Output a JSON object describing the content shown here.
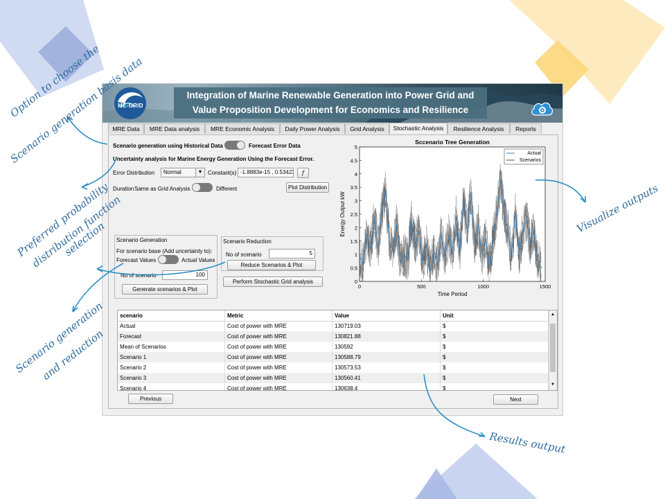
{
  "app": {
    "title_line1": "Integration of Marine Renewable Generation into Power Grid and",
    "title_line2": "Value Proposition Development for Economics and Resilience",
    "logo_text": "ME-GRID",
    "tabs": [
      "MRE Data",
      "MRE Data analysis",
      "MRE Economic Analysis",
      "Daily Power Analysis",
      "Grid Analysis",
      "Stochastic Analysis",
      "Resilience Analysis",
      "Reports"
    ],
    "active_tab": "Stochastic Analysis"
  },
  "controls": {
    "scen_gen_label": "Scenario generation using Historical Data",
    "forecast_error_label": "Forecast Error Data",
    "uncertainty_heading": "Uncertainty analysis for Marine Energy Generation Using the Forecast Error.",
    "error_dist_label": "Error Distribution",
    "error_dist_value": "Normal",
    "constants_label": "Constant(s)",
    "constants_value": "-1.8883e-15 , 0.53423",
    "fx_label": "f",
    "duration_label": "Duration",
    "same_as_grid_label": "Same as Grid Analysis",
    "different_label": "Different",
    "plot_dist_button": "Plot Distribution"
  },
  "scenario_generation": {
    "title": "Scenario Generation",
    "basis_label": "For scenario base (Add uncertainty to):",
    "forecast_values_label": "Forecast Values",
    "actual_values_label": "Actual Values",
    "no_scenario_label": "No of scenario",
    "no_scenario_value": "100",
    "generate_button": "Generate scenarios & Plot"
  },
  "scenario_reduction": {
    "title": "Scenario Reduction",
    "no_scenario_label": "No of scenario",
    "no_scenario_value": "5",
    "reduce_button": "Reduce Scenarios & Plot",
    "stochastic_button": "Perform Stochastic Grid analysis"
  },
  "chart_data": {
    "type": "line",
    "title": "Sccenario Tree Generation",
    "xlabel": "Time Period",
    "ylabel": "Energy Output kW",
    "xlim": [
      0,
      1500
    ],
    "ylim": [
      0,
      5
    ],
    "x_ticks": [
      "0",
      "500",
      "1000",
      "1500"
    ],
    "y_ticks": [
      "0",
      "0.5",
      "1",
      "1.5",
      "2",
      "2.5",
      "3",
      "3.5",
      "4",
      "4.5",
      "5"
    ],
    "legend_position": "top-right",
    "series": [
      {
        "name": "Actual",
        "color": "#3c7fb6",
        "x": [
          0,
          30,
          60,
          90,
          120,
          150,
          180,
          210,
          240,
          270,
          300,
          330,
          360,
          390,
          420,
          450,
          480,
          510,
          540,
          570,
          600,
          630,
          660,
          690,
          720,
          750,
          780,
          810,
          840,
          870,
          900,
          930,
          960,
          990,
          1020,
          1050,
          1080,
          1110,
          1140,
          1170,
          1200,
          1230,
          1260,
          1290,
          1320,
          1350,
          1380,
          1410,
          1440,
          1470
        ],
        "values": [
          1.0,
          0.6,
          1.8,
          1.2,
          2.4,
          1.3,
          2.6,
          3.4,
          1.5,
          1.2,
          2.1,
          0.7,
          1.0,
          0.8,
          2.3,
          1.4,
          1.9,
          0.7,
          1.4,
          0.3,
          1.2,
          0.6,
          1.8,
          0.9,
          1.7,
          1.0,
          2.4,
          1.1,
          3.0,
          1.9,
          3.3,
          1.4,
          2.1,
          1.0,
          1.6,
          0.5,
          1.6,
          2.6,
          3.8,
          2.4,
          1.9,
          0.8,
          2.6,
          1.0,
          1.9,
          2.3,
          1.4,
          1.9,
          0.8,
          0.5
        ]
      },
      {
        "name": "Scenarios",
        "color": "#505050"
      }
    ]
  },
  "table": {
    "headers": [
      "scenario",
      "Metric",
      "Value",
      "Unit"
    ],
    "rows": [
      [
        "Actual",
        "Cost of power with MRE",
        "130719.03",
        "$"
      ],
      [
        "Forecast",
        "Cost of power with MRE",
        "130821.88",
        "$"
      ],
      [
        "Mean of Scenarios",
        "Cost of power with MRE",
        "130592",
        "$"
      ],
      [
        "Scenario 1",
        "Cost of power with MRE",
        "130588.79",
        "$"
      ],
      [
        "Scenario 2",
        "Cost of power with MRE",
        "130573.53",
        "$"
      ],
      [
        "Scenario 3",
        "Cost of power with MRE",
        "130560.41",
        "$"
      ],
      [
        "Scenario 4",
        "Cost of power with MRE",
        "130638.4",
        "$"
      ]
    ]
  },
  "nav": {
    "previous": "Previous",
    "next": "Next"
  },
  "annotations": {
    "basis_line1": "Option to choose the",
    "basis_line2": "Scenario generation basis data",
    "dist_line1": "Preferred probability",
    "dist_line2": "distribution function",
    "dist_line3": "selection",
    "gen_line1": "Scenario generation",
    "gen_line2": "and reduction",
    "visualize": "Visualize outputs",
    "results": "Results output"
  },
  "colors": {
    "annotation": "#2f6c9e",
    "arrow": "#2b8fc4",
    "deco_blue": "#8fa8dc",
    "deco_yellow": "#fbd77a"
  }
}
